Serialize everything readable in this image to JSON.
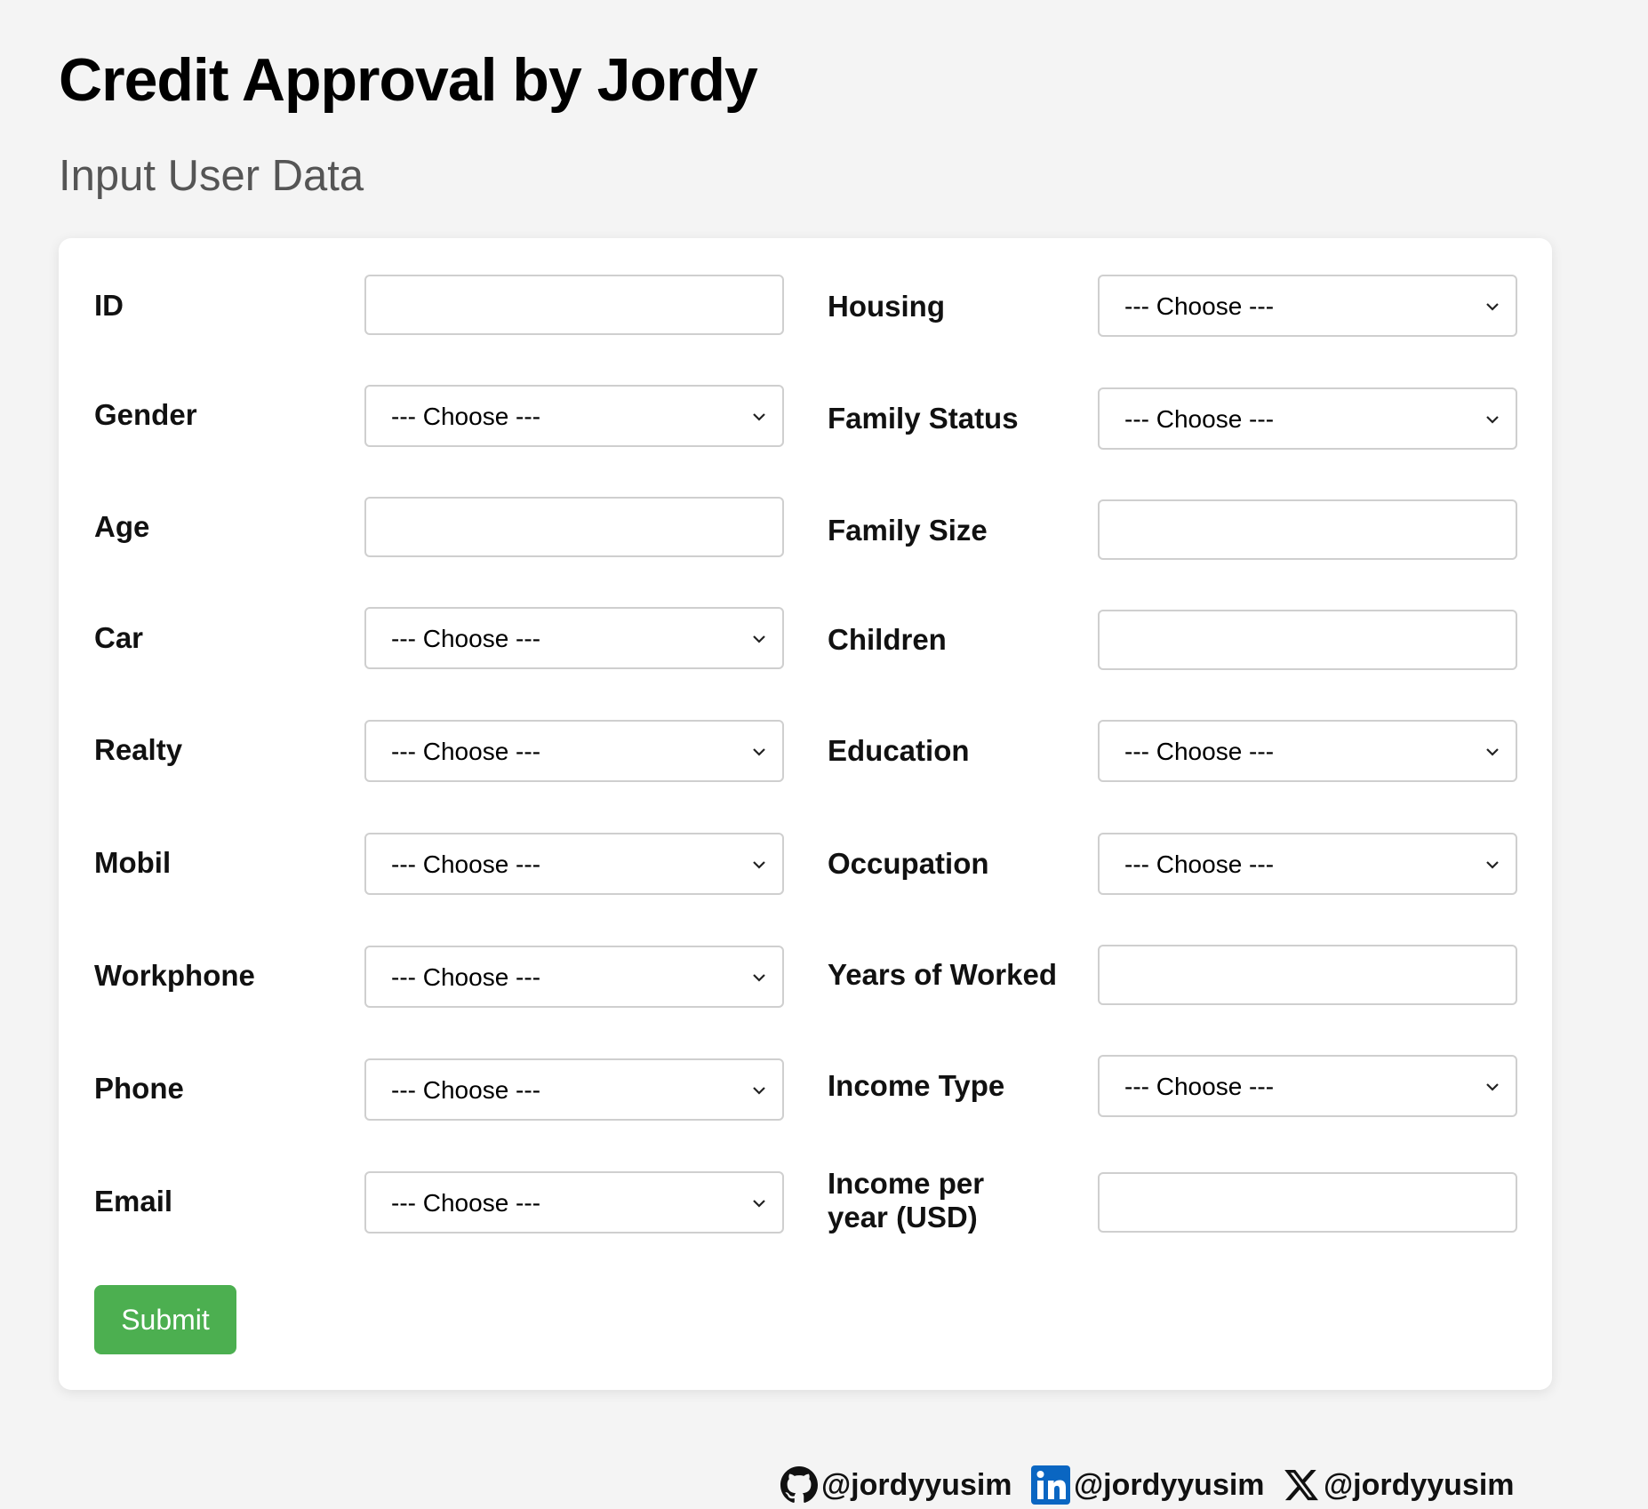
{
  "header": {
    "title": "Credit Approval by Jordy",
    "subtitle": "Input User Data"
  },
  "form": {
    "left_fields": [
      {
        "label": "ID",
        "type": "input",
        "value": ""
      },
      {
        "label": "Gender",
        "type": "select",
        "selected": "--- Choose ---"
      },
      {
        "label": "Age",
        "type": "input",
        "value": ""
      },
      {
        "label": "Car",
        "type": "select",
        "selected": "--- Choose ---"
      },
      {
        "label": "Realty",
        "type": "select",
        "selected": "--- Choose ---"
      },
      {
        "label": "Mobil",
        "type": "select",
        "selected": "--- Choose ---"
      },
      {
        "label": "Workphone",
        "type": "select",
        "selected": "--- Choose ---"
      },
      {
        "label": "Phone",
        "type": "select",
        "selected": "--- Choose ---"
      },
      {
        "label": "Email",
        "type": "select",
        "selected": "--- Choose ---"
      }
    ],
    "right_fields": [
      {
        "label": "Housing",
        "type": "select",
        "selected": "--- Choose ---"
      },
      {
        "label": "Family Status",
        "type": "select",
        "selected": "--- Choose ---"
      },
      {
        "label": "Family Size",
        "type": "input",
        "value": ""
      },
      {
        "label": "Children",
        "type": "input",
        "value": ""
      },
      {
        "label": "Education",
        "type": "select",
        "selected": "--- Choose ---"
      },
      {
        "label": "Occupation",
        "type": "select",
        "selected": "--- Choose ---"
      },
      {
        "label": "Years of Worked",
        "type": "input",
        "value": ""
      },
      {
        "label": "Income Type",
        "type": "select",
        "selected": "--- Choose ---"
      },
      {
        "label": "Income per year (USD)",
        "type": "input",
        "value": ""
      }
    ],
    "submit_label": "Submit"
  },
  "footer": {
    "links": [
      {
        "icon": "github-icon",
        "handle": "@jordyyusim"
      },
      {
        "icon": "linkedin-icon",
        "handle": "@jordyyusim"
      },
      {
        "icon": "x-icon",
        "handle": "@jordyyusim"
      }
    ]
  },
  "colors": {
    "background": "#f4f4f4",
    "card": "#ffffff",
    "submit": "#4caf50",
    "subtitle": "#555555",
    "border": "#cfcfcf",
    "linkedin": "#0a66c2"
  }
}
